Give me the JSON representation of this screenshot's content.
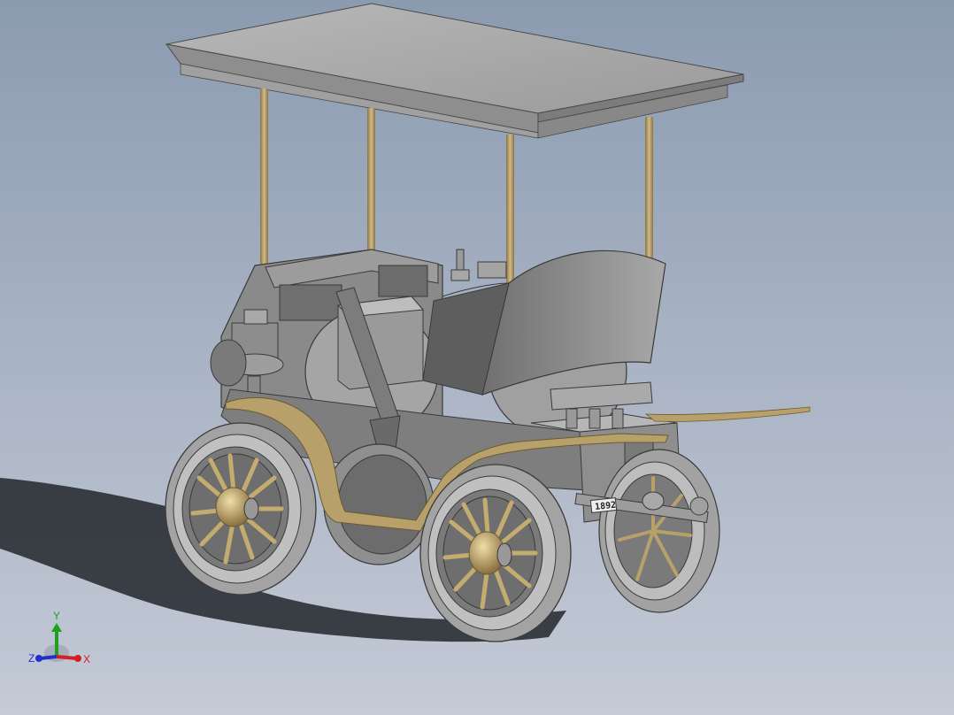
{
  "viewport": {
    "background_top": "#8b9bb0",
    "background_bottom": "#c4cad6"
  },
  "model": {
    "plate_text": "1892",
    "colors": {
      "body": "#8c8c8c",
      "body_light": "#b4b4b4",
      "body_dark": "#5a5a5a",
      "brass": "#b8a06a",
      "tire": "#9a9a9a",
      "shadow": "#2e3238"
    }
  },
  "triad": {
    "x_label": "X",
    "y_label": "Y",
    "z_label": "Z",
    "x_color": "#d42020",
    "y_color": "#20a020",
    "z_color": "#2030c8"
  }
}
